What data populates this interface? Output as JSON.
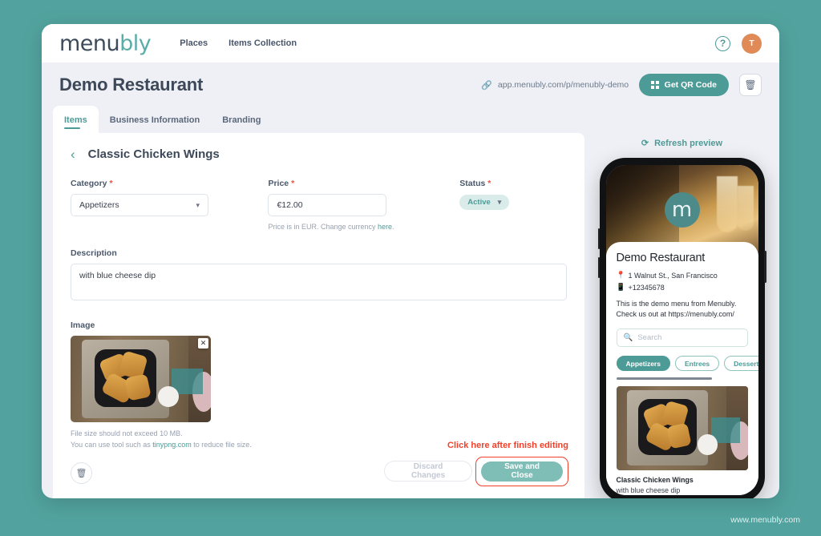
{
  "brand": {
    "logo_part1": "menu",
    "logo_part2": "bly",
    "accent": "#4d9b97",
    "page_bg": "#52a39f"
  },
  "topnav": {
    "links": [
      {
        "label": "Places"
      },
      {
        "label": "Items Collection"
      }
    ],
    "help_glyph": "?",
    "avatar_initial": "T"
  },
  "place_header": {
    "title": "Demo Restaurant",
    "url": "app.menubly.com/p/menubly-demo",
    "qr_button": "Get QR Code",
    "delete_glyph": "🗑"
  },
  "tabs": [
    {
      "label": "Items",
      "active": true
    },
    {
      "label": "Business Information",
      "active": false
    },
    {
      "label": "Branding",
      "active": false
    }
  ],
  "editor": {
    "back_glyph": "‹",
    "item_title": "Classic Chicken Wings",
    "category": {
      "label": "Category",
      "required": "*",
      "value": "Appetizers"
    },
    "price": {
      "label": "Price",
      "required": "*",
      "value": "€12.00",
      "hint_prefix": "Price is in EUR. Change currency ",
      "hint_link": "here",
      "hint_suffix": "."
    },
    "status": {
      "label": "Status",
      "required": "*",
      "value": "Active"
    },
    "description": {
      "label": "Description",
      "value": "with blue cheese dip",
      "placeholder": ""
    },
    "image": {
      "label": "Image",
      "remove_glyph": "✕",
      "hint_line1": "File size should not exceed 10 MB.",
      "hint_line2_prefix": "You can use tool such as ",
      "hint_line2_link": "tinypng.com",
      "hint_line2_suffix": " to reduce file size.",
      "delete_glyph": "🗑"
    },
    "callout": "Click here after finish editing",
    "discard_button": "Discard Changes",
    "save_button": "Save and Close"
  },
  "preview": {
    "refresh_label": "Refresh preview",
    "refresh_glyph": "⟳",
    "brand_mark": "m",
    "restaurant_name": "Demo Restaurant",
    "address": "1 Walnut St., San Francisco",
    "address_icon": "📍",
    "phone": "+12345678",
    "phone_icon": "📱",
    "about": "This is the demo menu from Menubly. Check us out at https://menubly.com/",
    "search_placeholder": "Search",
    "search_icon": "🔍",
    "categories": [
      {
        "label": "Appetizers",
        "selected": true
      },
      {
        "label": "Entrees",
        "selected": false
      },
      {
        "label": "Desserts",
        "selected": false
      },
      {
        "label": "(",
        "selected": false
      }
    ],
    "menu_item": {
      "name": "Classic Chicken Wings",
      "description": "with blue cheese dip"
    }
  },
  "footer": {
    "site": "www.menubly.com"
  }
}
